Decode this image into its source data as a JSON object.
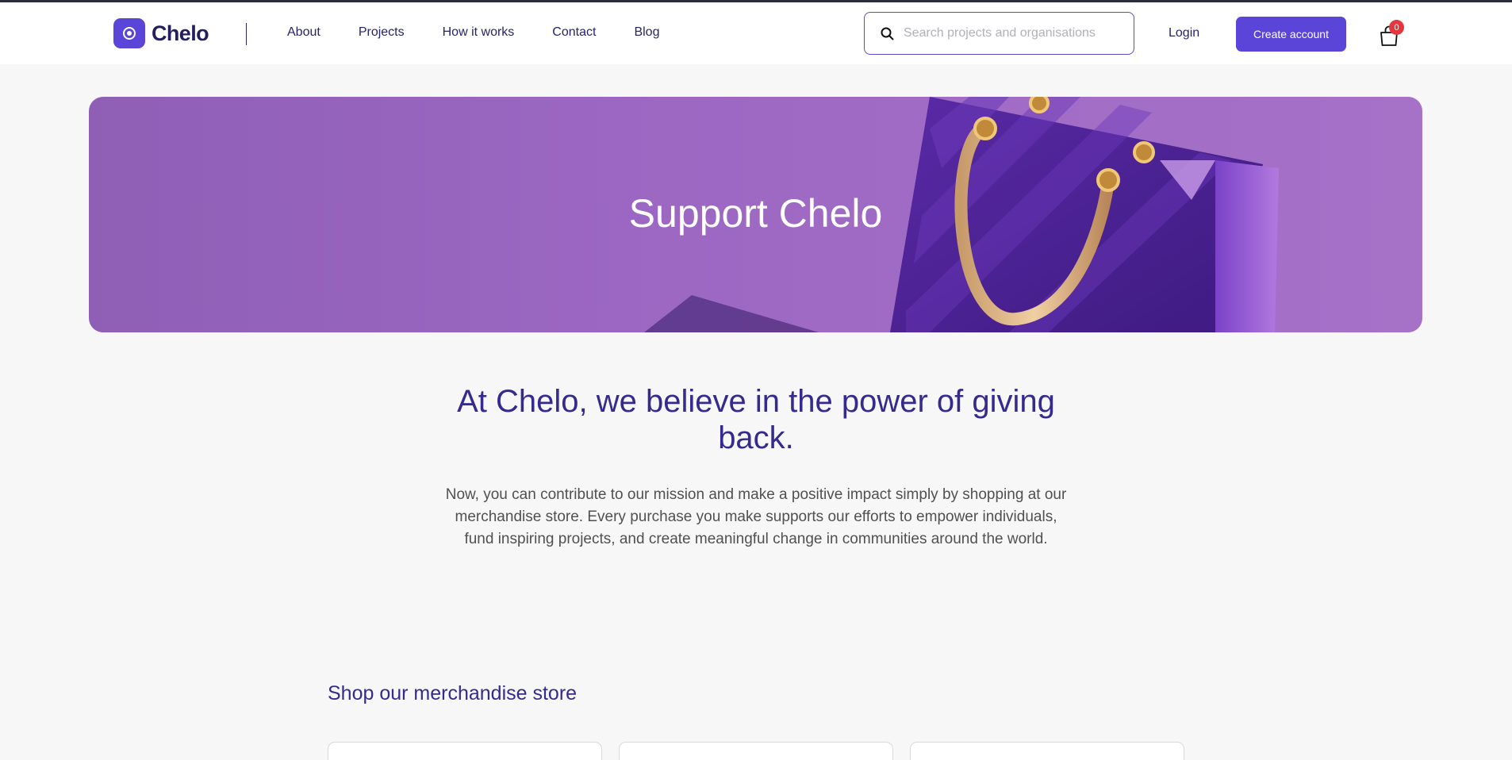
{
  "header": {
    "logo_text": "Chelo",
    "nav": [
      "About",
      "Projects",
      "How it works",
      "Contact",
      "Blog"
    ],
    "search_placeholder": "Search projects and organisations",
    "login_label": "Login",
    "create_account_label": "Create account",
    "cart_count": "0"
  },
  "hero": {
    "title": "Support Chelo"
  },
  "intro": {
    "title": "At Chelo, we believe in the power of giving back.",
    "body": "Now, you can contribute to our mission and make a positive impact simply by shopping at our merchandise store. Every purchase you make supports our efforts to empower individuals, fund inspiring projects, and create meaningful change in communities around the world."
  },
  "shop": {
    "title": "Shop our merchandise store"
  },
  "colors": {
    "brand": "#5b45d9",
    "heading": "#352a8e",
    "badge": "#e2373e"
  },
  "icons": {
    "search": "search-icon",
    "cart": "shopping-bag-icon",
    "logo": "logo-icon"
  }
}
